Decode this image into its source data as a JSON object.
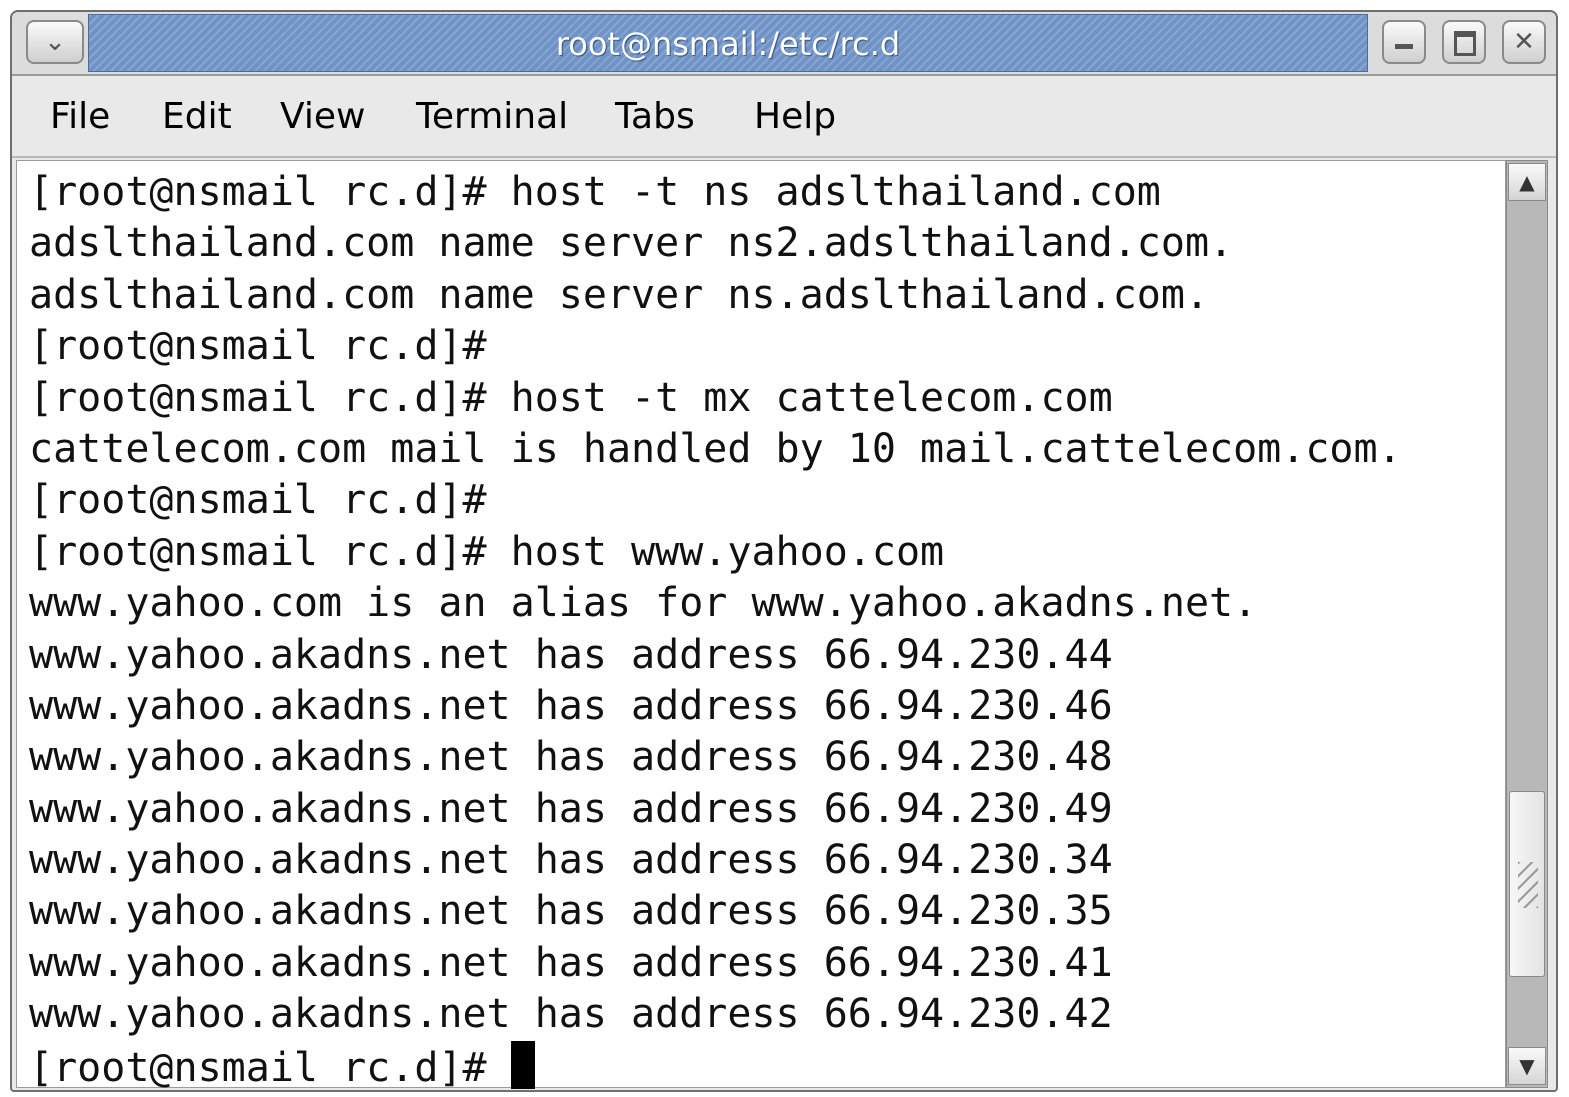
{
  "window": {
    "title": "root@nsmail:/etc/rc.d"
  },
  "menu": {
    "items": [
      "File",
      "Edit",
      "View",
      "Terminal",
      "Tabs",
      "Help"
    ]
  },
  "terminal": {
    "lines": [
      "[root@nsmail rc.d]# host -t ns adslthailand.com",
      "adslthailand.com name server ns2.adslthailand.com.",
      "adslthailand.com name server ns.adslthailand.com.",
      "[root@nsmail rc.d]#",
      "[root@nsmail rc.d]# host -t mx cattelecom.com",
      "cattelecom.com mail is handled by 10 mail.cattelecom.com.",
      "[root@nsmail rc.d]#",
      "[root@nsmail rc.d]# host www.yahoo.com",
      "www.yahoo.com is an alias for www.yahoo.akadns.net.",
      "www.yahoo.akadns.net has address 66.94.230.44",
      "www.yahoo.akadns.net has address 66.94.230.46",
      "www.yahoo.akadns.net has address 66.94.230.48",
      "www.yahoo.akadns.net has address 66.94.230.49",
      "www.yahoo.akadns.net has address 66.94.230.34",
      "www.yahoo.akadns.net has address 66.94.230.35",
      "www.yahoo.akadns.net has address 66.94.230.41",
      "www.yahoo.akadns.net has address 66.94.230.42"
    ],
    "prompt": "[root@nsmail rc.d]# "
  },
  "icons": {
    "window_menu": "chevron-down-icon",
    "minimize": "minimize-icon",
    "maximize": "maximize-icon",
    "close": "close-icon",
    "scroll_up": "arrow-up-icon",
    "scroll_down": "arrow-down-icon"
  },
  "colors": {
    "titlebar": "#6f93c6",
    "terminal_bg": "#ffffff",
    "terminal_fg": "#111111"
  }
}
